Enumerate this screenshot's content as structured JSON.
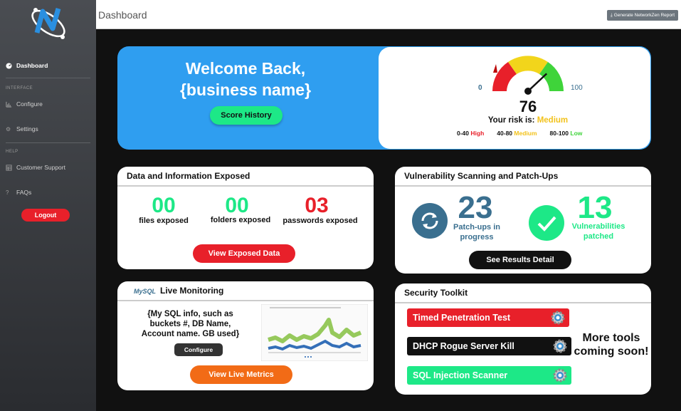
{
  "colors": {
    "accent_blue": "#2f9ef0",
    "green": "#1de887",
    "red": "#e8202a",
    "teal": "#3a6f8f"
  },
  "sidebar": {
    "items": [
      {
        "label": "Dashboard",
        "icon": "dashboard-gauge-icon"
      },
      {
        "label": "Configure",
        "icon": "chart-icon"
      },
      {
        "label": "Settings",
        "icon": "gear-icon"
      },
      {
        "label": "Customer Support",
        "icon": "table-icon"
      },
      {
        "label": "FAQs",
        "icon": "question-icon"
      }
    ],
    "section_interface": "INTERFACE",
    "section_help": "HELP",
    "logout": "Logout"
  },
  "header": {
    "title": "Dashboard",
    "report_button": "Generate NetworkZen Report"
  },
  "welcome": {
    "line1": "Welcome Back,",
    "line2": "{business name}",
    "button": "Score History"
  },
  "risk": {
    "score": "76",
    "score_value": 76,
    "min": "0",
    "max": "100",
    "label": "Your risk is:",
    "level": "Medium",
    "legend_high_range": "0-40",
    "legend_high": "High",
    "legend_medium_range": "40-80",
    "legend_medium": "Medium",
    "legend_low_range": "80-100",
    "legend_low": "Low"
  },
  "exposed": {
    "title": "Data and Information Exposed",
    "files_value": "00",
    "files_label": "files exposed",
    "folders_value": "00",
    "folders_label": "folders exposed",
    "passwords_value": "03",
    "passwords_label": "passwords exposed",
    "button": "View Exposed Data"
  },
  "vuln": {
    "title": "Vulnerability Scanning and Patch-Ups",
    "patch_value": "23",
    "patch_label1": "Patch-ups in",
    "patch_label2": "progress",
    "patched_value": "13",
    "patched_label1": "Vulnerabilities",
    "patched_label2": "patched",
    "button": "See Results Detail"
  },
  "live": {
    "logo": "MySQL",
    "title": "Live Monitoring",
    "info1": "{My SQL info, such as",
    "info2": "buckets #, DB Name,",
    "info3": "Account name. GB used}",
    "configure": "Configure",
    "button": "View Live Metrics"
  },
  "toolkit": {
    "title": "Security Toolkit",
    "tools": [
      {
        "label": "Timed Penetration Test",
        "color": "#e8202a"
      },
      {
        "label": "DHCP Rogue Server Kill",
        "color": "#111111"
      },
      {
        "label": "SQL Injection Scanner",
        "color": "#1de887"
      }
    ],
    "more1": "More tools",
    "more2": "coming soon!"
  }
}
